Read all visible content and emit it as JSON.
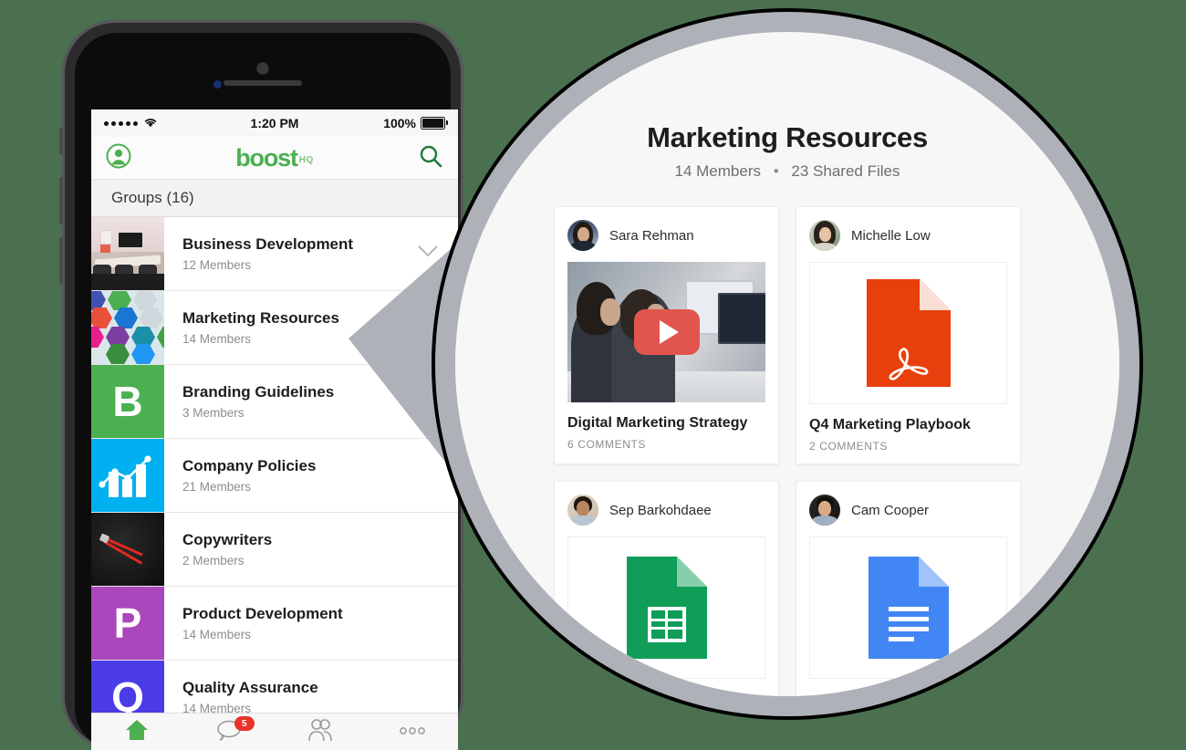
{
  "background_color": "#4a7050",
  "phone": {
    "status_bar": {
      "signal_dots": 5,
      "wifi_icon": "wifi-icon",
      "time": "1:20 PM",
      "battery_percent": "100%",
      "battery_icon": "battery-full-icon"
    },
    "nav_bar": {
      "profile_icon": "profile-avatar-icon",
      "logo_text": "boost",
      "logo_suffix": "HQ",
      "logo_color": "#4caf50",
      "search_icon": "search-icon"
    },
    "section_header": "Groups (16)",
    "groups": [
      {
        "name": "Business Development",
        "members": "12 Members",
        "thumb": "office-photo-thumbnail",
        "has_chevron": true,
        "chevron_icon": "chevron-down-icon"
      },
      {
        "name": "Marketing Resources",
        "members": "14 Members",
        "thumb": "marketing-icons-thumbnail",
        "has_chevron": false
      },
      {
        "name": "Branding Guidelines",
        "members": "3 Members",
        "thumb": "letter-tile-B",
        "letter": "B",
        "color": "#4caf50",
        "has_chevron": false
      },
      {
        "name": "Company Policies",
        "members": "21 Members",
        "thumb": "bar-chart-tile",
        "color": "#00b0f0",
        "has_chevron": false
      },
      {
        "name": "Copywriters",
        "members": "2 Members",
        "thumb": "red-pencils-photo",
        "color": "#141414",
        "has_chevron": false
      },
      {
        "name": "Product Development",
        "members": "14 Members",
        "thumb": "letter-tile-P",
        "letter": "P",
        "color": "#ab47bc",
        "has_chevron": false
      },
      {
        "name": "Quality Assurance",
        "members": "14 Members",
        "thumb": "letter-tile-Q",
        "letter": "Q",
        "color": "#4b3ce8",
        "has_chevron": false
      }
    ],
    "tab_bar": [
      {
        "name": "home-tab",
        "icon": "home-icon",
        "active": true,
        "badge": ""
      },
      {
        "name": "chat-tab",
        "icon": "chat-bubble-icon",
        "active": false,
        "badge": "5"
      },
      {
        "name": "people-tab",
        "icon": "people-icon",
        "active": false,
        "badge": ""
      },
      {
        "name": "more-tab",
        "icon": "more-dots-icon",
        "active": false,
        "badge": ""
      }
    ],
    "badge_color": "#e8322a"
  },
  "magnifier": {
    "ring_color": "#aeb2b8",
    "outline_color": "#000000",
    "title": "Marketing Resources",
    "subtitle_members": "14 Members",
    "subtitle_bullet": "•",
    "subtitle_files": "23 Shared Files",
    "cards": [
      {
        "author": "Sara Rehman",
        "avatar": "avatar-sara-rehman",
        "media_type": "video-thumbnail",
        "play_icon": "play-button-icon",
        "title": "Digital Marketing Strategy",
        "comments": "6 COMMENTS"
      },
      {
        "author": "Michelle Low",
        "avatar": "avatar-michelle-low",
        "media_type": "pdf-file-icon",
        "file_color": "#e8400d",
        "title": "Q4 Marketing Playbook",
        "comments": "2 COMMENTS"
      },
      {
        "author": "Sep Barkohdaee",
        "avatar": "avatar-sep-barkohdaee",
        "media_type": "google-sheets-icon",
        "file_color": "#0f9d58",
        "title": "",
        "comments": ""
      },
      {
        "author": "Cam Cooper",
        "avatar": "avatar-cam-cooper",
        "media_type": "google-docs-icon",
        "file_color": "#4285f4",
        "title": "",
        "comments": ""
      }
    ]
  }
}
